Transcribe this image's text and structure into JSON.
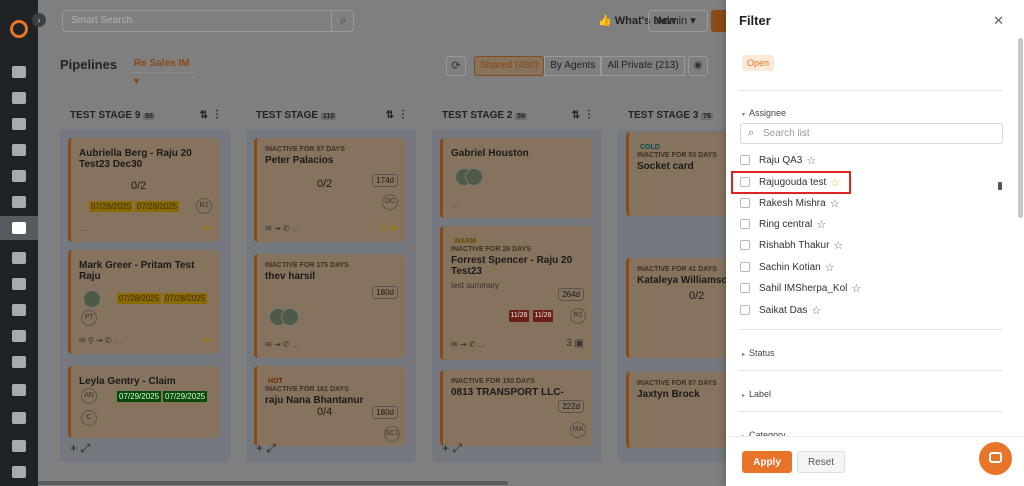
{
  "topbar": {
    "search_placeholder": "Smart Search",
    "whats_new": "What's New",
    "role": "Admin"
  },
  "pipeline": {
    "title": "Pipelines",
    "selected": "Re Sales IM",
    "tabs": [
      "Shared (480)",
      "By Agents",
      "All Private (213)"
    ]
  },
  "columns": [
    {
      "name": "TEST STAGE 9",
      "count": "86",
      "cards": [
        {
          "name": "Aubriella Berg - Raju 20 Test23 Dec30",
          "frac": "0/2",
          "dates": [
            "07/28/2025",
            "07/28/2025"
          ],
          "initials": "R2"
        },
        {
          "name": "Mark Greer - Pritam Test Raju",
          "dates": [
            "07/28/2025",
            "07/28/2025"
          ],
          "initials": "PT"
        },
        {
          "name": "Leyla Gentry - Claim",
          "dates": [
            "07/29/2025",
            "07/29/2025"
          ],
          "initials": "AN",
          "initials2": "C"
        }
      ]
    },
    {
      "name": "TEST STAGE",
      "count": "110",
      "cards": [
        {
          "inactive": "INACTIVE FOR 57 DAYS",
          "name": "Peter Palacios",
          "frac": "0/2",
          "days": "174d",
          "initials": "DC",
          "extra": "3"
        },
        {
          "inactive": "INACTIVE FOR 175 DAYS",
          "name": "thev harsil",
          "days": "180d"
        },
        {
          "tag": "HOT",
          "inactive": "INACTIVE FOR 161 DAYS",
          "name": "raju Nana Bhantanur",
          "frac": "0/4",
          "days": "180d",
          "initials": "SC1"
        }
      ]
    },
    {
      "name": "TEST STAGE 2",
      "count": "59",
      "cards": [
        {
          "name": "Gabriel Houston"
        },
        {
          "tag": "WARM",
          "inactive": "INACTIVE FOR 26 DAYS",
          "name": "Forrest Spencer - Raju 20 Test23",
          "summary": "test summary",
          "days": "264d",
          "red_tags": [
            "11/26",
            "11/26"
          ],
          "initials": "R2",
          "extra": "3"
        },
        {
          "inactive": "INACTIVE FOR 150 DAYS",
          "name": "0813 TRANSPORT LLC-",
          "days": "222d",
          "initials": "MA"
        }
      ]
    },
    {
      "name": "TEST STAGE 3",
      "count": "76",
      "cards": [
        {
          "tag": "COLD",
          "inactive": "INACTIVE FOR 53 DAYS",
          "name": "Socket card"
        },
        {
          "inactive": "INACTIVE FOR 41 DAYS",
          "name": "Kataleya Williamso",
          "frac": "0/2"
        },
        {
          "inactive": "INACTIVE FOR 87 DAYS",
          "name": "Jaxtyn Brock"
        }
      ]
    }
  ],
  "filter": {
    "title": "Filter",
    "status_chip": "Open",
    "assignee_label": "Assignee",
    "search_placeholder": "Search list",
    "assignees": [
      "Raju QA3",
      "Rajugouda test",
      "Rakesh Mishra",
      "Ring central",
      "Rishabh Thakur",
      "Sachin Kotian",
      "Sahil IMSherpa_Kol",
      "Saikat Das"
    ],
    "sections": [
      "Status",
      "Label",
      "Category"
    ],
    "apply_label": "Apply",
    "reset_label": "Reset"
  },
  "colors": {
    "accent": "#e8742a",
    "highlight": "#e02424"
  }
}
